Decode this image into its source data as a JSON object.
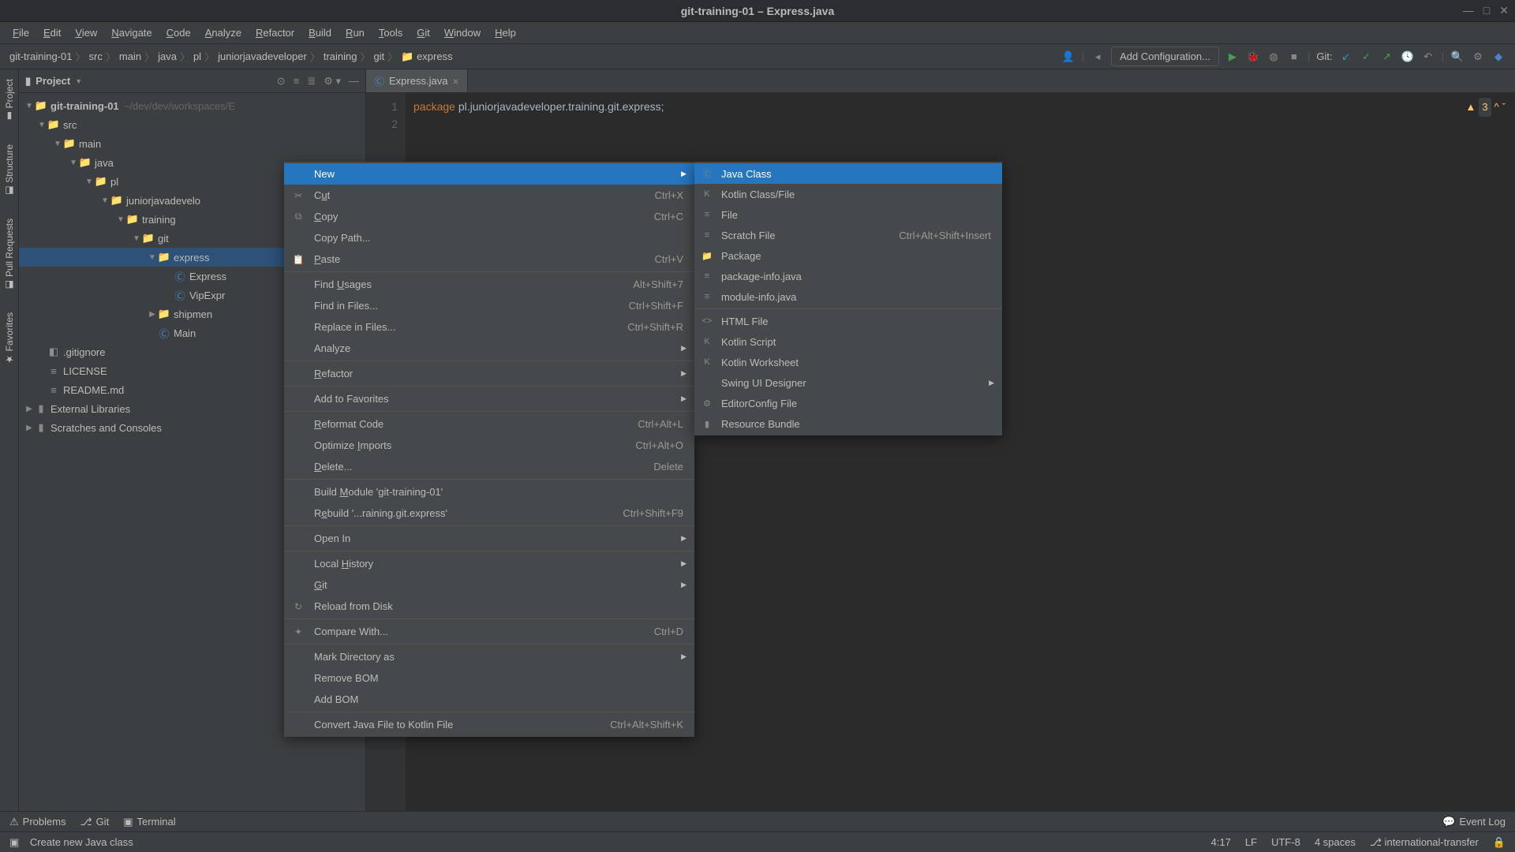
{
  "titlebar": {
    "title": "git-training-01 – Express.java"
  },
  "menu": {
    "items": [
      "File",
      "Edit",
      "View",
      "Navigate",
      "Code",
      "Analyze",
      "Refactor",
      "Build",
      "Run",
      "Tools",
      "Git",
      "Window",
      "Help"
    ]
  },
  "breadcrumbs": [
    "git-training-01",
    "src",
    "main",
    "java",
    "pl",
    "juniorjavadeveloper",
    "training",
    "git",
    "express"
  ],
  "toolbar": {
    "config": "Add Configuration...",
    "git_label": "Git:"
  },
  "project": {
    "header": "Project",
    "root": {
      "name": "git-training-01",
      "path": "~/dev/dev/workspaces/E"
    },
    "tree": [
      {
        "depth": 0,
        "expand": "▼",
        "icon": "📁",
        "label": "src"
      },
      {
        "depth": 1,
        "expand": "▼",
        "icon": "📁",
        "label": "main"
      },
      {
        "depth": 2,
        "expand": "▼",
        "icon": "📁",
        "label": "java"
      },
      {
        "depth": 3,
        "expand": "▼",
        "icon": "📁",
        "label": "pl"
      },
      {
        "depth": 4,
        "expand": "▼",
        "icon": "📁",
        "label": "juniorjavadevelo"
      },
      {
        "depth": 5,
        "expand": "▼",
        "icon": "📁",
        "label": "training"
      },
      {
        "depth": 6,
        "expand": "▼",
        "icon": "📁",
        "label": "git"
      },
      {
        "depth": 7,
        "expand": "▼",
        "icon": "📁",
        "label": "express",
        "selected": true
      },
      {
        "depth": 8,
        "expand": "",
        "icon": "Ⓒ",
        "label": "Express"
      },
      {
        "depth": 8,
        "expand": "",
        "icon": "Ⓒ",
        "label": "VipExpr"
      },
      {
        "depth": 7,
        "expand": "▶",
        "icon": "📁",
        "label": "shipmen"
      },
      {
        "depth": 7,
        "expand": "",
        "icon": "Ⓒ",
        "label": "Main"
      },
      {
        "depth": 0,
        "expand": "",
        "icon": "◧",
        "label": ".gitignore"
      },
      {
        "depth": 0,
        "expand": "",
        "icon": "≡",
        "label": "LICENSE"
      },
      {
        "depth": 0,
        "expand": "",
        "icon": "≡",
        "label": "README.md"
      }
    ],
    "extras": [
      "External Libraries",
      "Scratches and Consoles"
    ]
  },
  "tabs": {
    "active": "Express.java"
  },
  "code": {
    "line1_kw": "package",
    "line1_rest": " pl.juniorjavadeveloper.training.git.express;",
    "line4_tail": "\");",
    "warnings": "3"
  },
  "context_menu": [
    {
      "label": "New",
      "hl": true,
      "sub": true
    },
    {
      "icon": "✂",
      "label": "Cut",
      "shortcut": "Ctrl+X",
      "mnem": 1
    },
    {
      "icon": "⧉",
      "label": "Copy",
      "shortcut": "Ctrl+C",
      "mnem": 0
    },
    {
      "label": "Copy Path..."
    },
    {
      "icon": "📋",
      "label": "Paste",
      "shortcut": "Ctrl+V",
      "mnem": 0
    },
    {
      "sep": true
    },
    {
      "label": "Find Usages",
      "shortcut": "Alt+Shift+7",
      "mnem": 5
    },
    {
      "label": "Find in Files...",
      "shortcut": "Ctrl+Shift+F"
    },
    {
      "label": "Replace in Files...",
      "shortcut": "Ctrl+Shift+R"
    },
    {
      "label": "Analyze",
      "sub": true
    },
    {
      "sep": true
    },
    {
      "label": "Refactor",
      "sub": true,
      "mnem": 0
    },
    {
      "sep": true
    },
    {
      "label": "Add to Favorites",
      "sub": true
    },
    {
      "sep": true
    },
    {
      "label": "Reformat Code",
      "shortcut": "Ctrl+Alt+L",
      "mnem": 0
    },
    {
      "label": "Optimize Imports",
      "shortcut": "Ctrl+Alt+O",
      "mnem": 9
    },
    {
      "label": "Delete...",
      "shortcut": "Delete",
      "mnem": 0
    },
    {
      "sep": true
    },
    {
      "label": "Build Module 'git-training-01'",
      "mnem": 6
    },
    {
      "label": "Rebuild '...raining.git.express'",
      "shortcut": "Ctrl+Shift+F9",
      "mnem": 1
    },
    {
      "sep": true
    },
    {
      "label": "Open In",
      "sub": true
    },
    {
      "sep": true
    },
    {
      "label": "Local History",
      "sub": true,
      "mnem": 6
    },
    {
      "label": "Git",
      "sub": true,
      "mnem": 0
    },
    {
      "icon": "↻",
      "label": "Reload from Disk"
    },
    {
      "sep": true
    },
    {
      "icon": "✦",
      "label": "Compare With...",
      "shortcut": "Ctrl+D"
    },
    {
      "sep": true
    },
    {
      "label": "Mark Directory as",
      "sub": true
    },
    {
      "label": "Remove BOM"
    },
    {
      "label": "Add BOM"
    },
    {
      "sep": true
    },
    {
      "label": "Convert Java File to Kotlin File",
      "shortcut": "Ctrl+Alt+Shift+K"
    }
  ],
  "submenu": [
    {
      "icon": "Ⓒ",
      "label": "Java Class",
      "hl": true
    },
    {
      "icon": "K",
      "label": "Kotlin Class/File"
    },
    {
      "icon": "≡",
      "label": "File"
    },
    {
      "icon": "≡",
      "label": "Scratch File",
      "shortcut": "Ctrl+Alt+Shift+Insert"
    },
    {
      "icon": "📁",
      "label": "Package"
    },
    {
      "icon": "≡",
      "label": "package-info.java"
    },
    {
      "icon": "≡",
      "label": "module-info.java"
    },
    {
      "sep": true
    },
    {
      "icon": "<>",
      "label": "HTML File"
    },
    {
      "icon": "K",
      "label": "Kotlin Script"
    },
    {
      "icon": "K",
      "label": "Kotlin Worksheet"
    },
    {
      "label": "Swing UI Designer",
      "sub": true
    },
    {
      "icon": "⚙",
      "label": "EditorConfig File"
    },
    {
      "icon": "▮",
      "label": "Resource Bundle"
    }
  ],
  "side_tabs": [
    "Project",
    "Structure",
    "Pull Requests",
    "Favorites"
  ],
  "bottom": {
    "tabs": [
      {
        "icon": "⚠",
        "label": "Problems"
      },
      {
        "icon": "⎇",
        "label": "Git"
      },
      {
        "icon": "▣",
        "label": "Terminal"
      }
    ],
    "event_log": "Event Log"
  },
  "status": {
    "hint": "Create new Java class",
    "pos": "4:17",
    "le": "LF",
    "enc": "UTF-8",
    "indent": "4 spaces",
    "branch": "international-transfer"
  }
}
